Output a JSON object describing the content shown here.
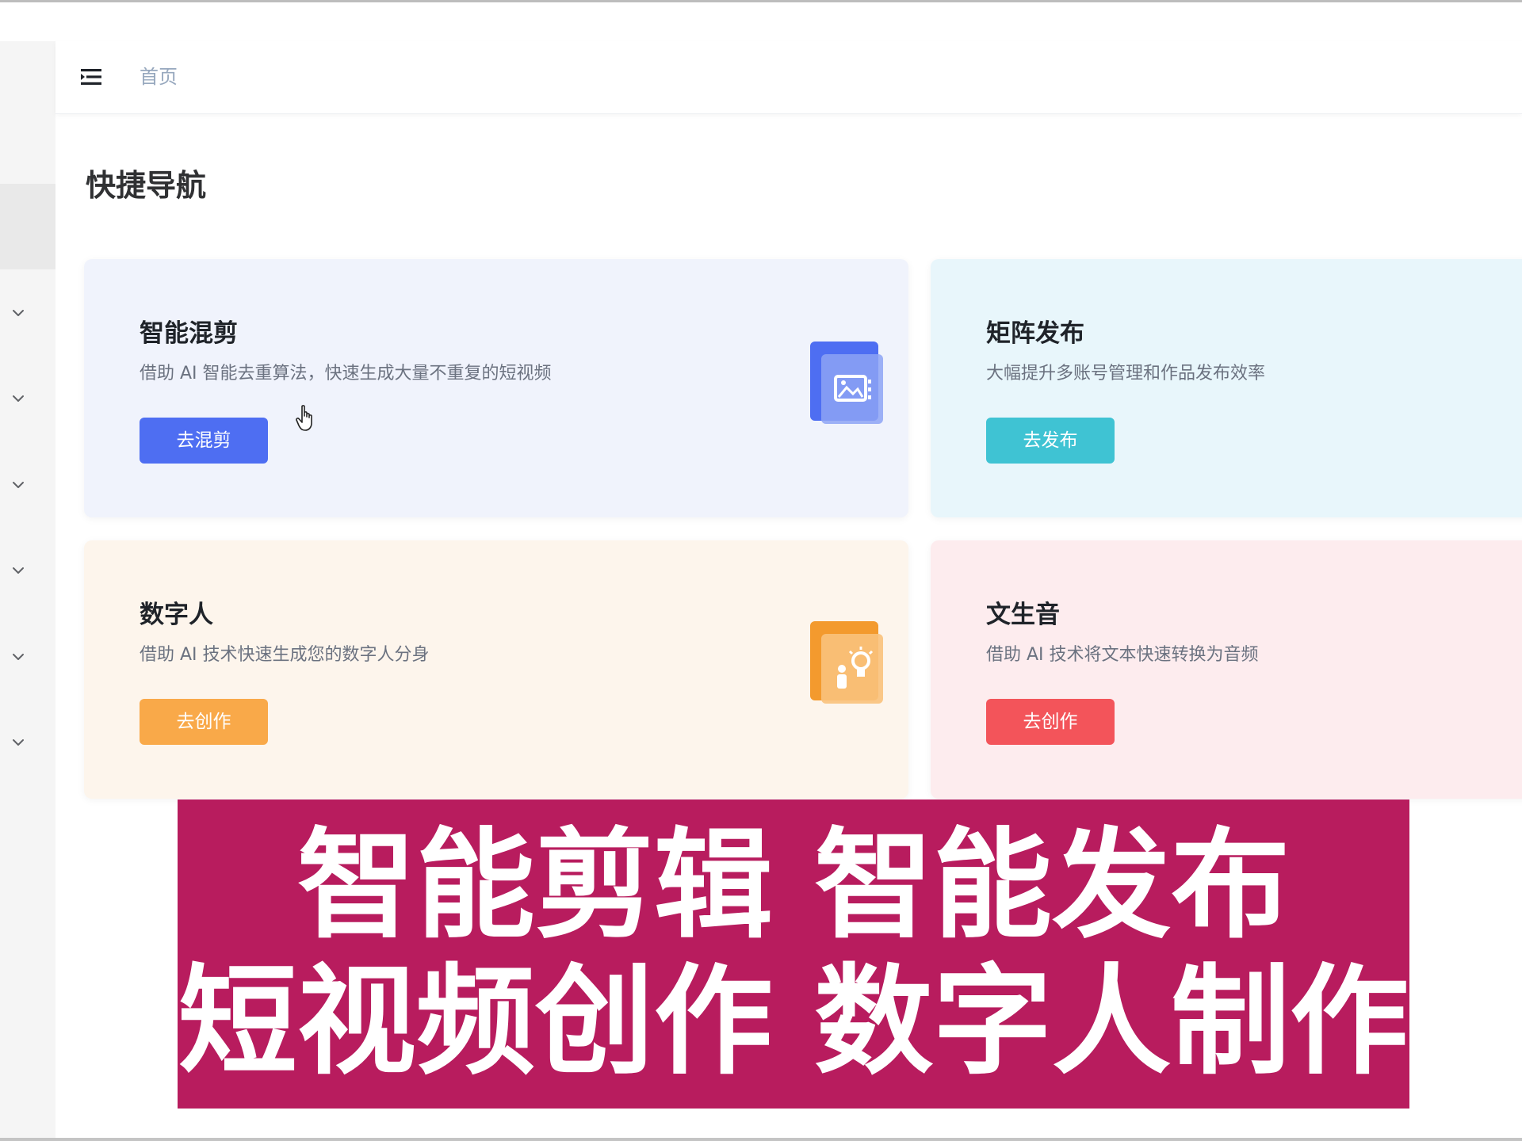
{
  "header": {
    "breadcrumb": "首页"
  },
  "page": {
    "title": "快捷导航"
  },
  "cards": [
    {
      "title": "智能混剪",
      "desc": "借助 AI 智能去重算法，快速生成大量不重复的短视频",
      "button": "去混剪",
      "bg": "#f0f3fc",
      "button_color": "#4e6ef2",
      "icon": "image-gallery-icon"
    },
    {
      "title": "矩阵发布",
      "desc": "大幅提升多账号管理和作品发布效率",
      "button": "去发布",
      "bg": "#e8f6fb",
      "button_color": "#3fc3d3"
    },
    {
      "title": "数字人",
      "desc": "借助 AI 技术快速生成您的数字人分身",
      "button": "去创作",
      "bg": "#fdf5ec",
      "button_color": "#f9a949",
      "icon": "person-idea-icon"
    },
    {
      "title": "文生音",
      "desc": "借助 AI 技术将文本快速转换为音频",
      "button": "去创作",
      "bg": "#fdecee",
      "button_color": "#f3545a"
    }
  ],
  "banner": {
    "line1": "智能剪辑 智能发布",
    "line2": "短视频创作 数字人制作",
    "bg": "#b81c5e"
  },
  "sidebar": {
    "chevron_count": 6
  }
}
